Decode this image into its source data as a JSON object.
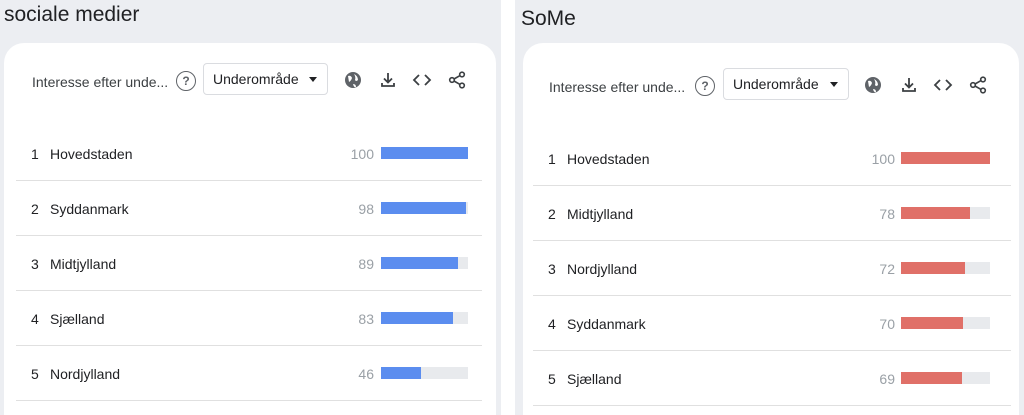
{
  "left": {
    "title": "sociale medier",
    "toolbar": {
      "label": "Interesse efter unde...",
      "dropdown": "Underområde"
    },
    "bar_color": "#5b8def",
    "rows": [
      {
        "rank": "1",
        "name": "Hovedstaden",
        "value": "100",
        "fraction": 1.0
      },
      {
        "rank": "2",
        "name": "Syddanmark",
        "value": "98",
        "fraction": 0.98
      },
      {
        "rank": "3",
        "name": "Midtjylland",
        "value": "89",
        "fraction": 0.89
      },
      {
        "rank": "4",
        "name": "Sjælland",
        "value": "83",
        "fraction": 0.83
      },
      {
        "rank": "5",
        "name": "Nordjylland",
        "value": "46",
        "fraction": 0.46
      }
    ]
  },
  "right": {
    "title": "SoMe",
    "toolbar": {
      "label": "Interesse efter unde...",
      "dropdown": "Underområde"
    },
    "bar_color": "#e07068",
    "rows": [
      {
        "rank": "1",
        "name": "Hovedstaden",
        "value": "100",
        "fraction": 1.0
      },
      {
        "rank": "2",
        "name": "Midtjylland",
        "value": "78",
        "fraction": 0.78
      },
      {
        "rank": "3",
        "name": "Nordjylland",
        "value": "72",
        "fraction": 0.72
      },
      {
        "rank": "4",
        "name": "Syddanmark",
        "value": "70",
        "fraction": 0.7
      },
      {
        "rank": "5",
        "name": "Sjælland",
        "value": "69",
        "fraction": 0.69
      }
    ]
  },
  "icons": {
    "help": "?",
    "toolbar": [
      "globe-icon",
      "download-icon",
      "embed-icon",
      "share-icon"
    ]
  }
}
